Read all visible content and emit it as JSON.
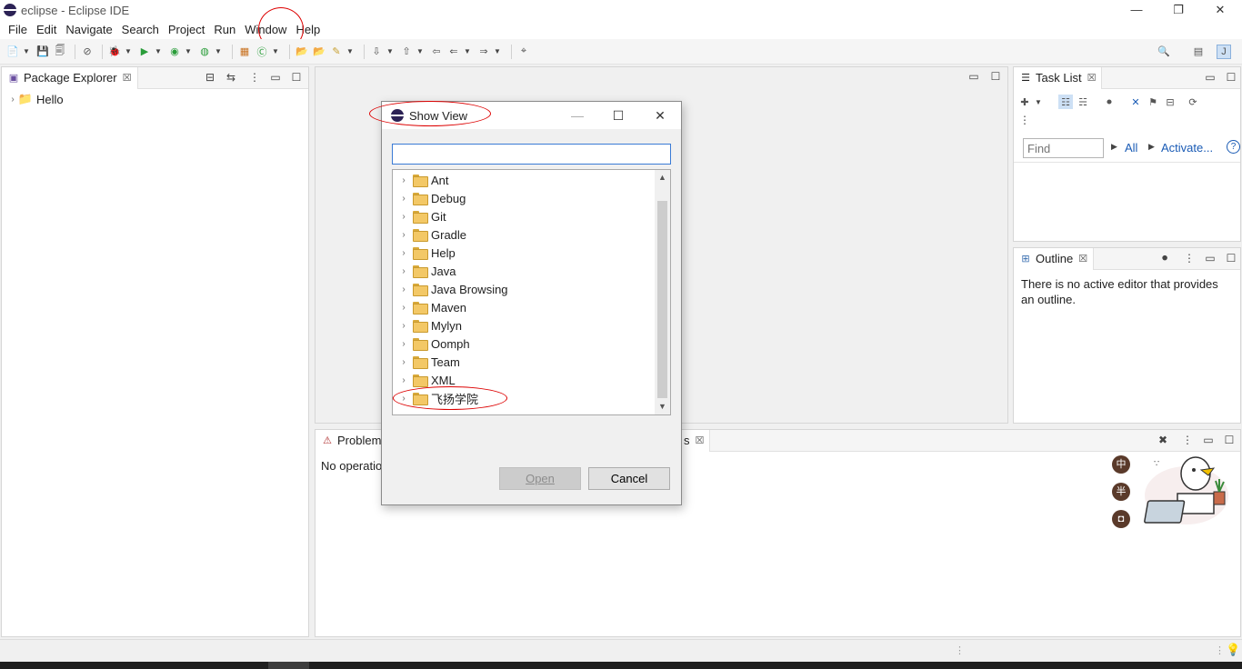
{
  "window": {
    "title": "eclipse - Eclipse IDE",
    "minimize_icon": "minimize-icon",
    "restore_icon": "restore-icon",
    "close_icon": "close-icon"
  },
  "menubar": {
    "items": [
      "File",
      "Edit",
      "Navigate",
      "Search",
      "Project",
      "Run",
      "Window",
      "Help"
    ]
  },
  "package_explorer": {
    "title": "Package Explorer",
    "tree": [
      {
        "label": "Hello"
      }
    ]
  },
  "task_list": {
    "title": "Task List",
    "find_placeholder": "Find",
    "all_label": "All",
    "activate_label": "Activate...",
    "help_glyph": "?"
  },
  "outline": {
    "title": "Outline",
    "message": "There is no active editor that provides an outline."
  },
  "bottom_panel": {
    "tab_left": "Problem",
    "tab_right_suffix": "s",
    "message_start": "No operatio"
  },
  "dialog": {
    "title": "Show View",
    "filter_value": "",
    "items": [
      "Ant",
      "Debug",
      "Git",
      "Gradle",
      "Help",
      "Java",
      "Java Browsing",
      "Maven",
      "Mylyn",
      "Oomph",
      "Team",
      "XML",
      "飞扬学院"
    ],
    "open_label": "Open",
    "cancel_label": "Cancel"
  },
  "ime_widget": {
    "buttons": [
      "中",
      "半",
      "◘"
    ]
  },
  "colors": {
    "accent": "#3a7bd5",
    "annotation": "#dd0000",
    "link": "#1a5bb5"
  }
}
